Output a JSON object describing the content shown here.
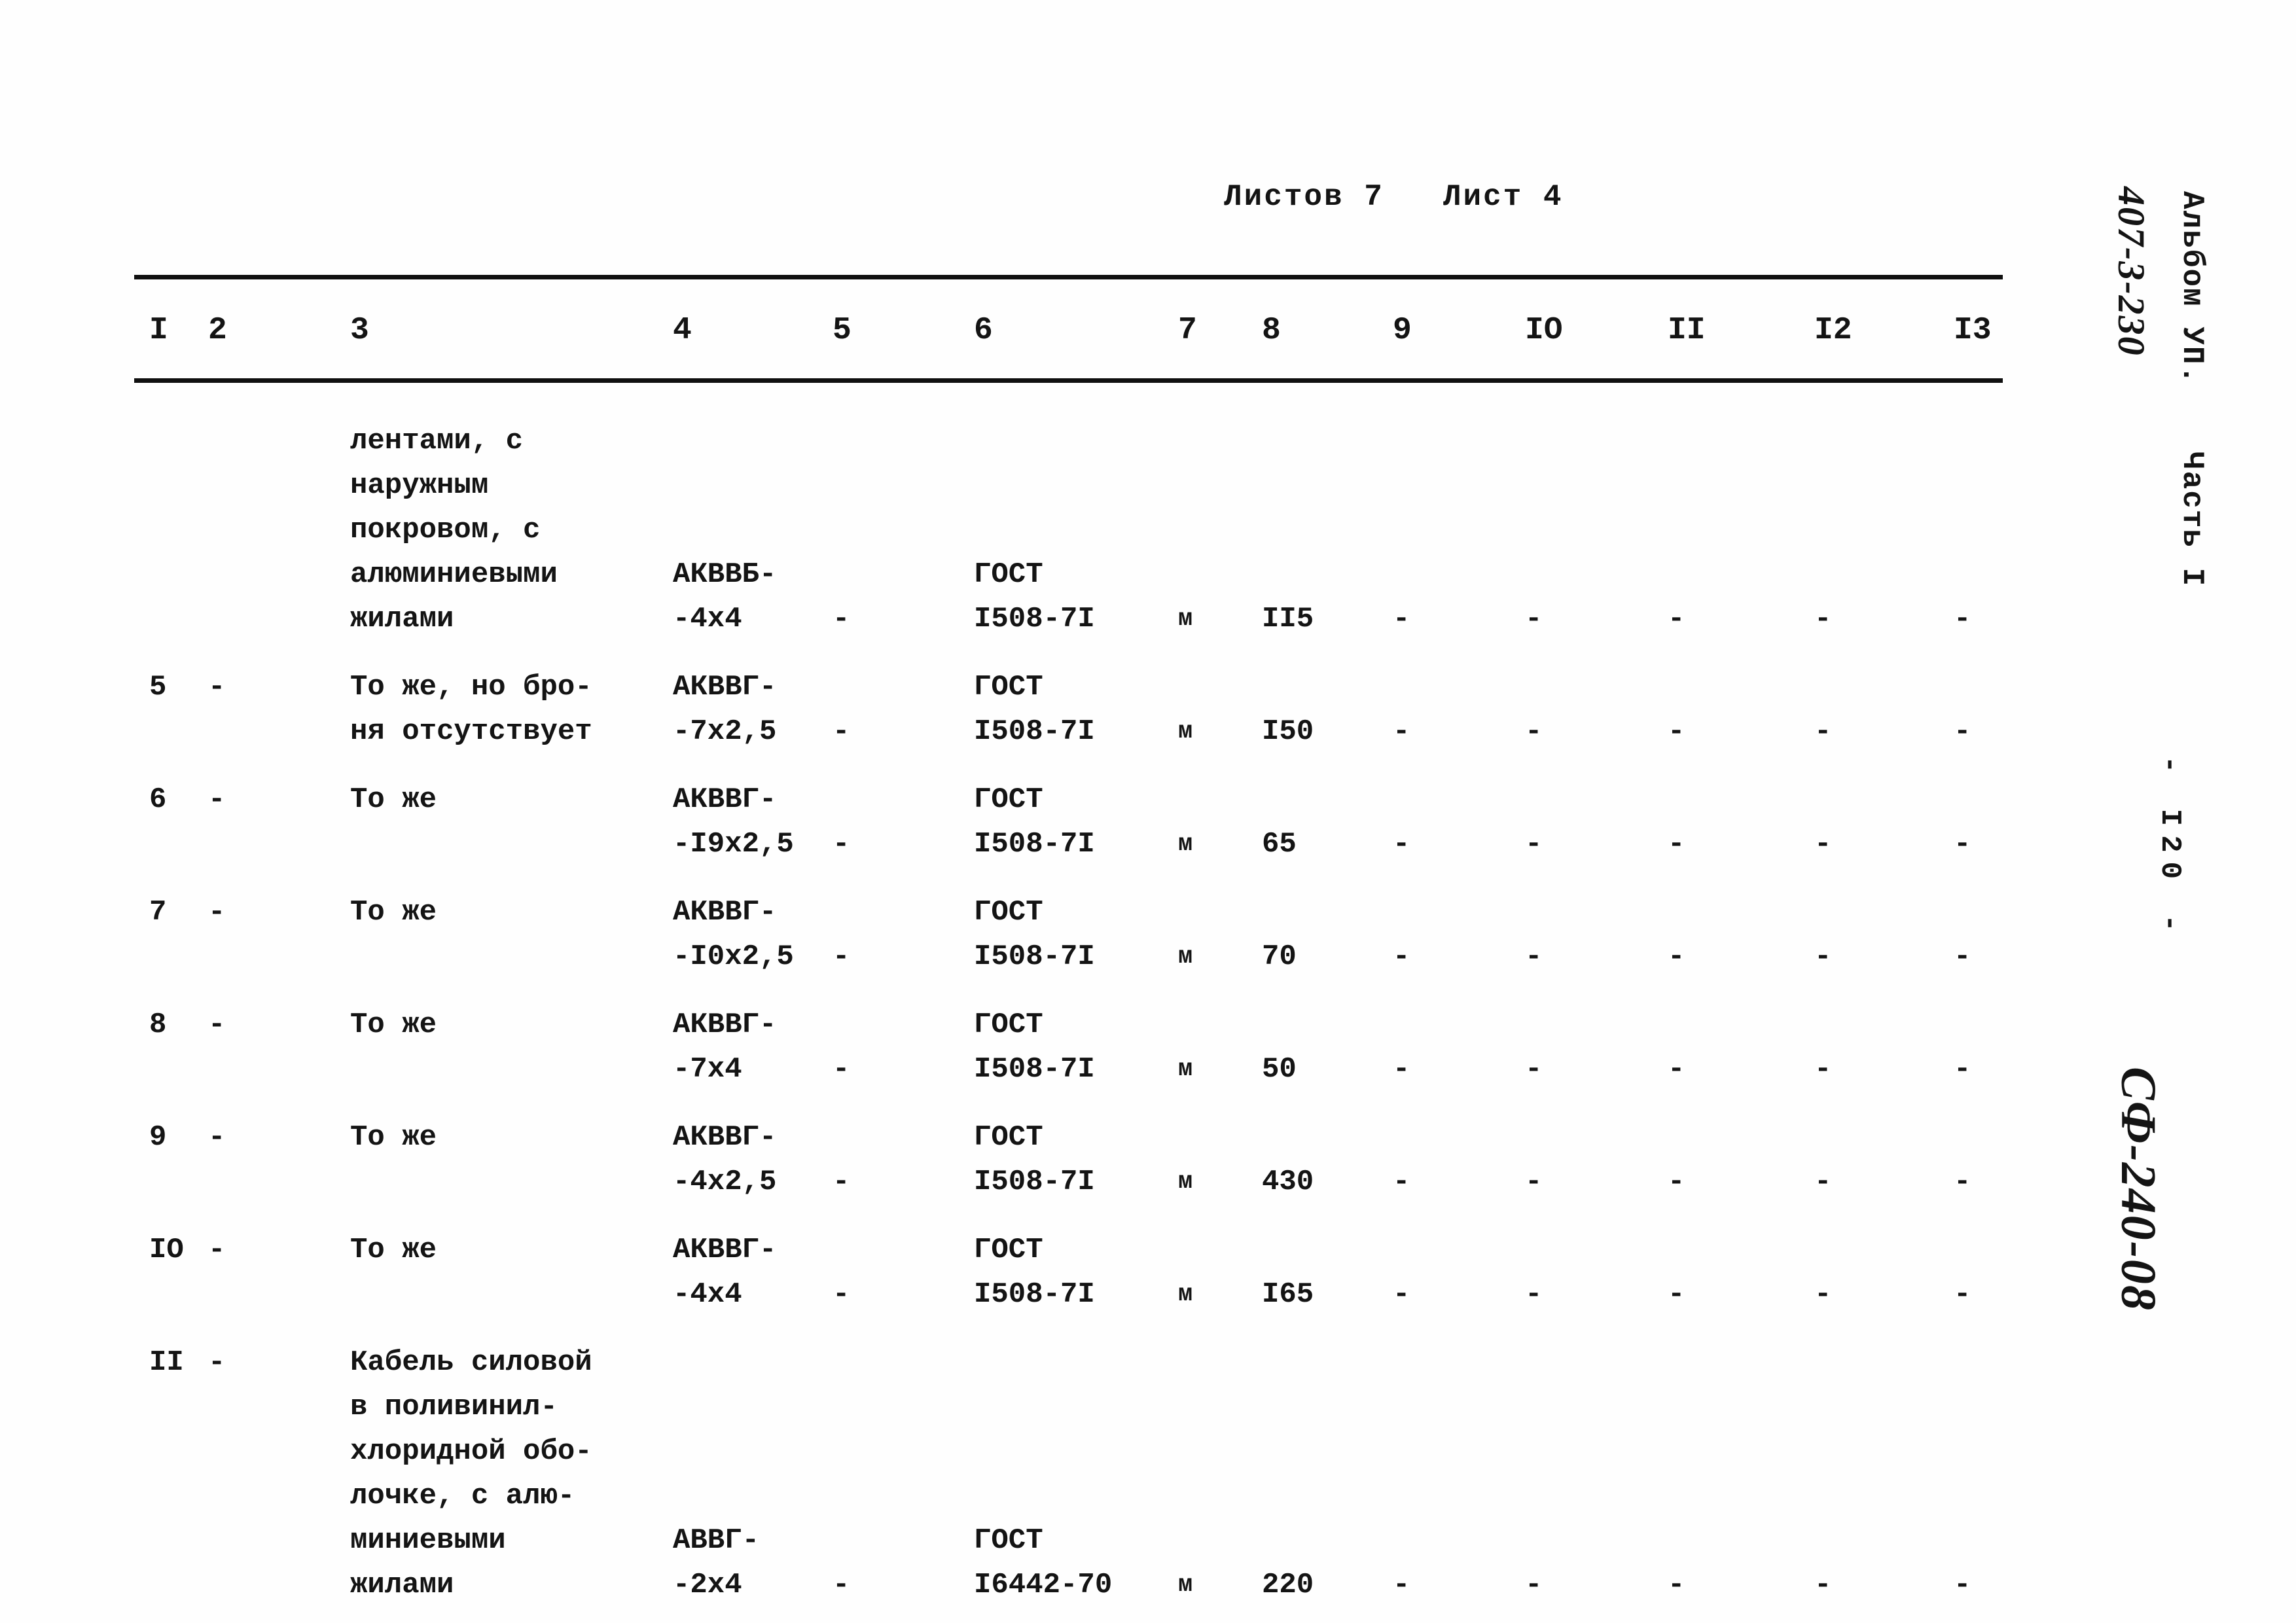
{
  "sheet_header": {
    "sheets_total_label": "Листов 7",
    "sheet_current_label": "Лист 4"
  },
  "column_headers": [
    "I",
    "2",
    "3",
    "4",
    "5",
    "6",
    "7",
    "8",
    "9",
    "IO",
    "II",
    "I2",
    "I3"
  ],
  "rows": [
    {
      "num": "",
      "col2": "",
      "description": "лентами, с\nнаружным\nпокровом, с\nалюминиевыми\nжилами",
      "mark": "АКВВБ-\n-4х4",
      "col5": "-",
      "standard": "ГОСТ\nI508-7I",
      "unit": "м",
      "qty": "II5",
      "col9": "-",
      "col10": "-",
      "col11": "-",
      "col12": "-",
      "col13": "-"
    },
    {
      "num": "5",
      "col2": "-",
      "description": "То же, но бро-\nня отсутствует",
      "mark": "АКВВГ-\n-7х2,5",
      "col5": "-",
      "standard": "ГОСТ\nI508-7I",
      "unit": "м",
      "qty": "I50",
      "col9": "-",
      "col10": "-",
      "col11": "-",
      "col12": "-",
      "col13": "-"
    },
    {
      "num": "6",
      "col2": "-",
      "description": "То же",
      "mark": "АКВВГ-\n-I9х2,5",
      "col5": "-",
      "standard": "ГОСТ\nI508-7I",
      "unit": "м",
      "qty": "65",
      "col9": "-",
      "col10": "-",
      "col11": "-",
      "col12": "-",
      "col13": "-"
    },
    {
      "num": "7",
      "col2": "-",
      "description": "То же",
      "mark": "АКВВГ-\n-I0х2,5",
      "col5": "-",
      "standard": "ГОСТ\nI508-7I",
      "unit": "м",
      "qty": "70",
      "col9": "-",
      "col10": "-",
      "col11": "-",
      "col12": "-",
      "col13": "-"
    },
    {
      "num": "8",
      "col2": "-",
      "description": "То же",
      "mark": "АКВВГ-\n-7х4",
      "col5": "-",
      "standard": "ГОСТ\nI508-7I",
      "unit": "м",
      "qty": "50",
      "col9": "-",
      "col10": "-",
      "col11": "-",
      "col12": "-",
      "col13": "-"
    },
    {
      "num": "9",
      "col2": "-",
      "description": "То же",
      "mark": "АКВВГ-\n-4х2,5",
      "col5": "-",
      "standard": "ГОСТ\nI508-7I",
      "unit": "м",
      "qty": "430",
      "col9": "-",
      "col10": "-",
      "col11": "-",
      "col12": "-",
      "col13": "-"
    },
    {
      "num": "IO",
      "col2": "-",
      "description": "То же",
      "mark": "АКВВГ-\n-4х4",
      "col5": "-",
      "standard": "ГОСТ\nI508-7I",
      "unit": "м",
      "qty": "I65",
      "col9": "-",
      "col10": "-",
      "col11": "-",
      "col12": "-",
      "col13": "-"
    },
    {
      "num": "II",
      "col2": "-",
      "description": "Кабель силовой\nв поливинил-\nхлоридной обо-\nлочке, с алю-\nминиевыми\nжилами",
      "mark": "АВВГ-\n-2х4",
      "col5": "-",
      "standard": "ГОСТ\nI6442-70",
      "unit": "м",
      "qty": "220",
      "col9": "-",
      "col10": "-",
      "col11": "-",
      "col12": "-",
      "col13": "-"
    }
  ],
  "margin": {
    "project_code": "407-3-230",
    "album": "Альбом УП.",
    "part": "Часть I",
    "page_number": "- I20 -",
    "archive_stamp": "СФ-240-08"
  }
}
